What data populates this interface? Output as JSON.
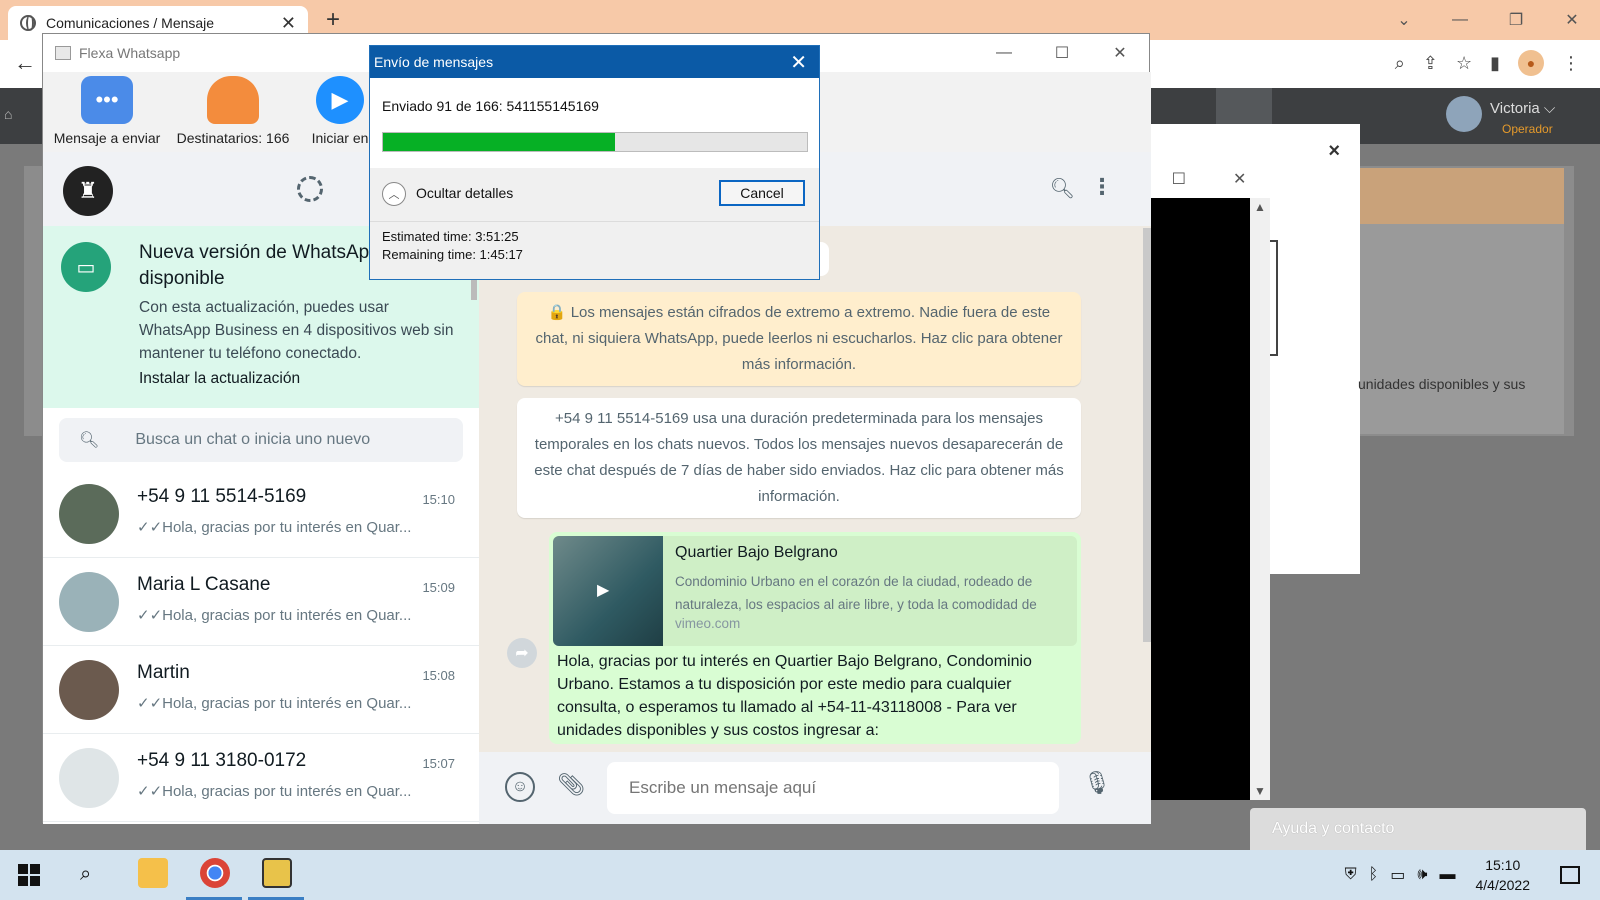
{
  "browser": {
    "tab_title": "Comunicaciones / Mensaje",
    "tab_close": "✕",
    "new_tab": "+",
    "back": "←"
  },
  "webapp": {
    "user_name": "Victoria ⌵",
    "user_role": "Operador",
    "side_text": "unidades disponibles y sus",
    "help_label": "Ayuda y contacto",
    "modal_close": "×"
  },
  "flexa": {
    "title": "Flexa Whatsapp",
    "toolbar": {
      "message_label": "Mensaje a enviar",
      "recipients_label": "Destinatarios: 166",
      "start_label": "Iniciar en"
    }
  },
  "whatsapp": {
    "banner": {
      "title": "Nueva versión de WhatsApp disponible",
      "description": "Con esta actualización, puedes usar WhatsApp Business en 4 dispositivos web sin mantener tu teléfono conectado.",
      "link": "Instalar la actualización"
    },
    "search_placeholder": "Busca un chat o inicia uno nuevo",
    "chats": [
      {
        "name": "+54 9 11 5514-5169",
        "time": "15:10",
        "preview": "✓✓Hola, gracias por tu interés en Quar...",
        "avatar_color": "#5b6b5a"
      },
      {
        "name": "Maria L Casane",
        "time": "15:09",
        "preview": "✓✓Hola, gracias por tu interés en Quar...",
        "avatar_color": "#9ab2b8"
      },
      {
        "name": "Martin",
        "time": "15:08",
        "preview": "✓✓Hola, gracias por tu interés en Quar...",
        "avatar_color": "#6b5a4e"
      },
      {
        "name": "+54 9 11 3180-0172",
        "time": "15:07",
        "preview": "✓✓Hola, gracias por tu interés en Quar...",
        "avatar_color": "#dfe5e7"
      }
    ],
    "chat": {
      "date_label": "Y",
      "encryption_notice": "🔒 Los mensajes están cifrados de extremo a extremo. Nadie fuera de este chat, ni siquiera WhatsApp, puede leerlos ni escucharlos. Haz clic para obtener más información.",
      "temporary_notice": "+54 9 11 5514-5169 usa una duración predeterminada para los mensajes temporales en los chats nuevos. Todos los mensajes nuevos desaparecerán de este chat después de 7 días de haber sido enviados. Haz clic para obtener más información.",
      "link_title": "Quartier Bajo Belgrano",
      "link_description": "Condominio Urbano en el corazón de la ciudad, rodeado de naturaleza, los espacios al aire libre, y toda la comodidad de",
      "link_domain": "vimeo.com",
      "message_text": "Hola, gracias por tu interés en Quartier Bajo Belgrano, Condominio Urbano. Estamos a tu disposición por este medio para cualquier consulta, o esperamos tu llamado al +54-11-43118008  - Para ver unidades disponibles y sus costos ingresar a:"
    },
    "compose_placeholder": "Escribe un mensaje aquí"
  },
  "dialog": {
    "title": "Envío de mensajes",
    "status": "Enviado 91 de 166: 541155145169",
    "progress_fraction": 0.548,
    "details_label": "Ocultar detalles",
    "cancel_label": "Cancel",
    "estimated_time": "Estimated time: 3:51:25",
    "remaining_time": "Remaining time: 1:45:17"
  },
  "taskbar": {
    "time": "15:10",
    "date": "4/4/2022"
  }
}
